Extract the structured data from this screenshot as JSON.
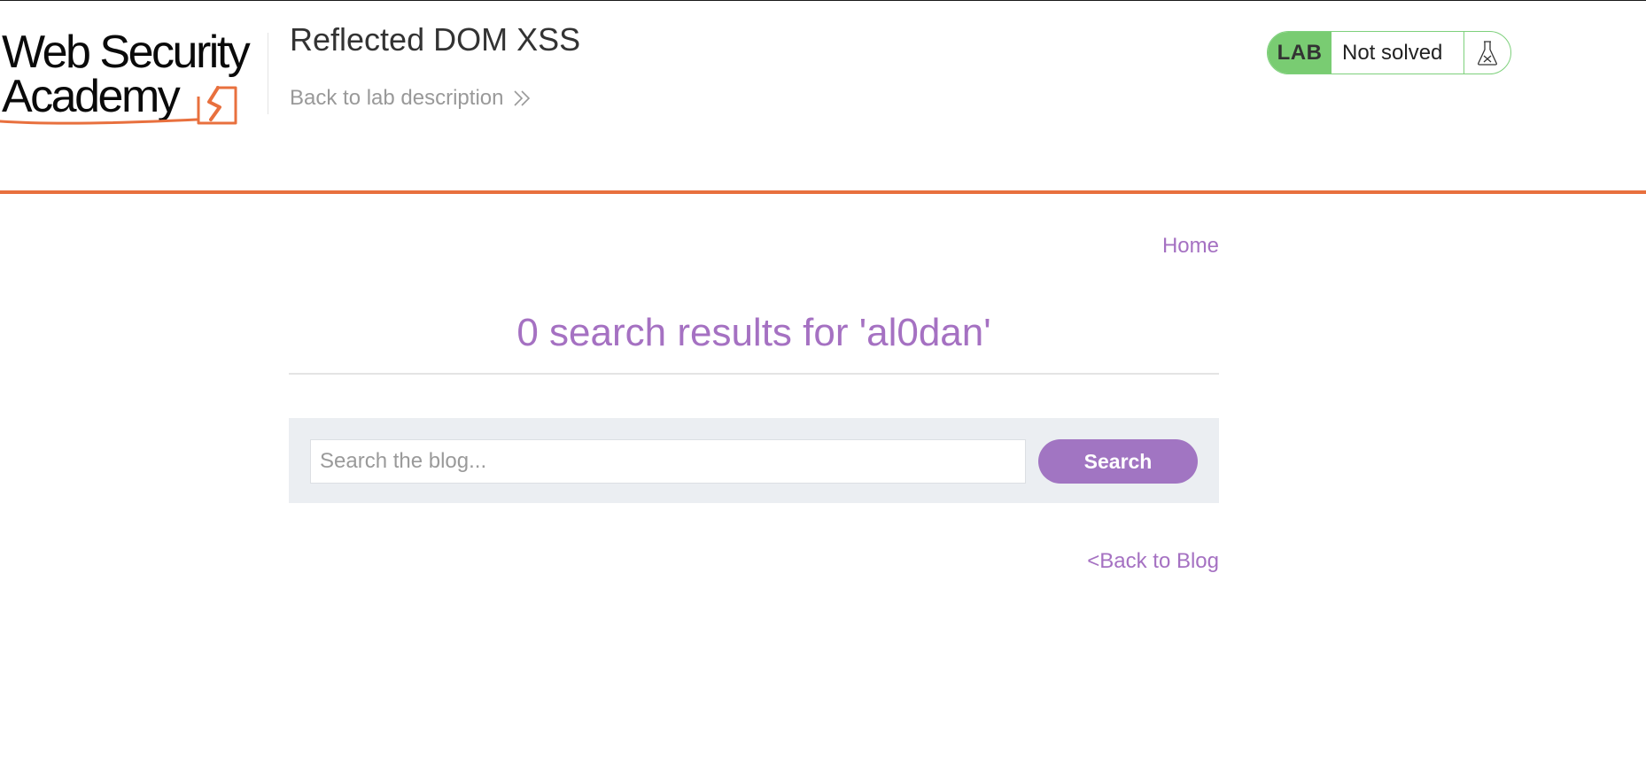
{
  "header": {
    "logo_line1": "Web Security",
    "logo_line2": "Academy",
    "lab_title": "Reflected DOM XSS",
    "back_to_description": "Back to lab description",
    "lab_badge": "LAB",
    "lab_status": "Not solved",
    "accent_color": "#e8703e",
    "status_color": "#79cc72"
  },
  "nav": {
    "home_label": "Home"
  },
  "results": {
    "heading": "0 search results for 'al0dan'"
  },
  "search": {
    "placeholder": "Search the blog...",
    "value": "",
    "button_label": "Search"
  },
  "footer_nav": {
    "back_to_blog": "<Back to Blog"
  },
  "icons": {
    "chevron": "double-chevron-right-icon",
    "flask": "flask-icon",
    "logo": "lightning-logo-icon"
  },
  "colors": {
    "link_purple": "#a571c2",
    "button_purple": "#a175c2",
    "panel_bg": "#ebeef2"
  }
}
